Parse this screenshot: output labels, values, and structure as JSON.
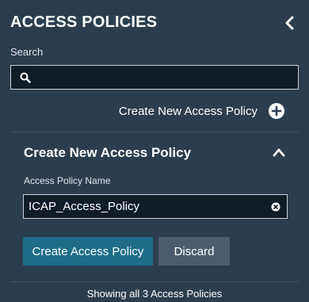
{
  "panel": {
    "title": "ACCESS POLICIES"
  },
  "search": {
    "label": "Search",
    "value": "",
    "placeholder": ""
  },
  "create_link": {
    "label": "Create New Access Policy"
  },
  "create_section": {
    "title": "Create New Access Policy",
    "field_label": "Access Policy Name",
    "field_value": "ICAP_Access_Policy",
    "create_button": "Create Access Policy",
    "discard_button": "Discard"
  },
  "footer": {
    "status": "Showing all 3 Access Policies"
  },
  "icons": {
    "collapse": "chevron-left-icon",
    "search": "search-icon",
    "add": "plus-circle-icon",
    "section_toggle": "chevron-up-icon",
    "clear": "close-circle-icon"
  },
  "colors": {
    "background": "#2b3e50",
    "input_background": "#0f1d29",
    "primary_button": "#1d6c8a",
    "secondary_button": "#4a5d6e"
  }
}
